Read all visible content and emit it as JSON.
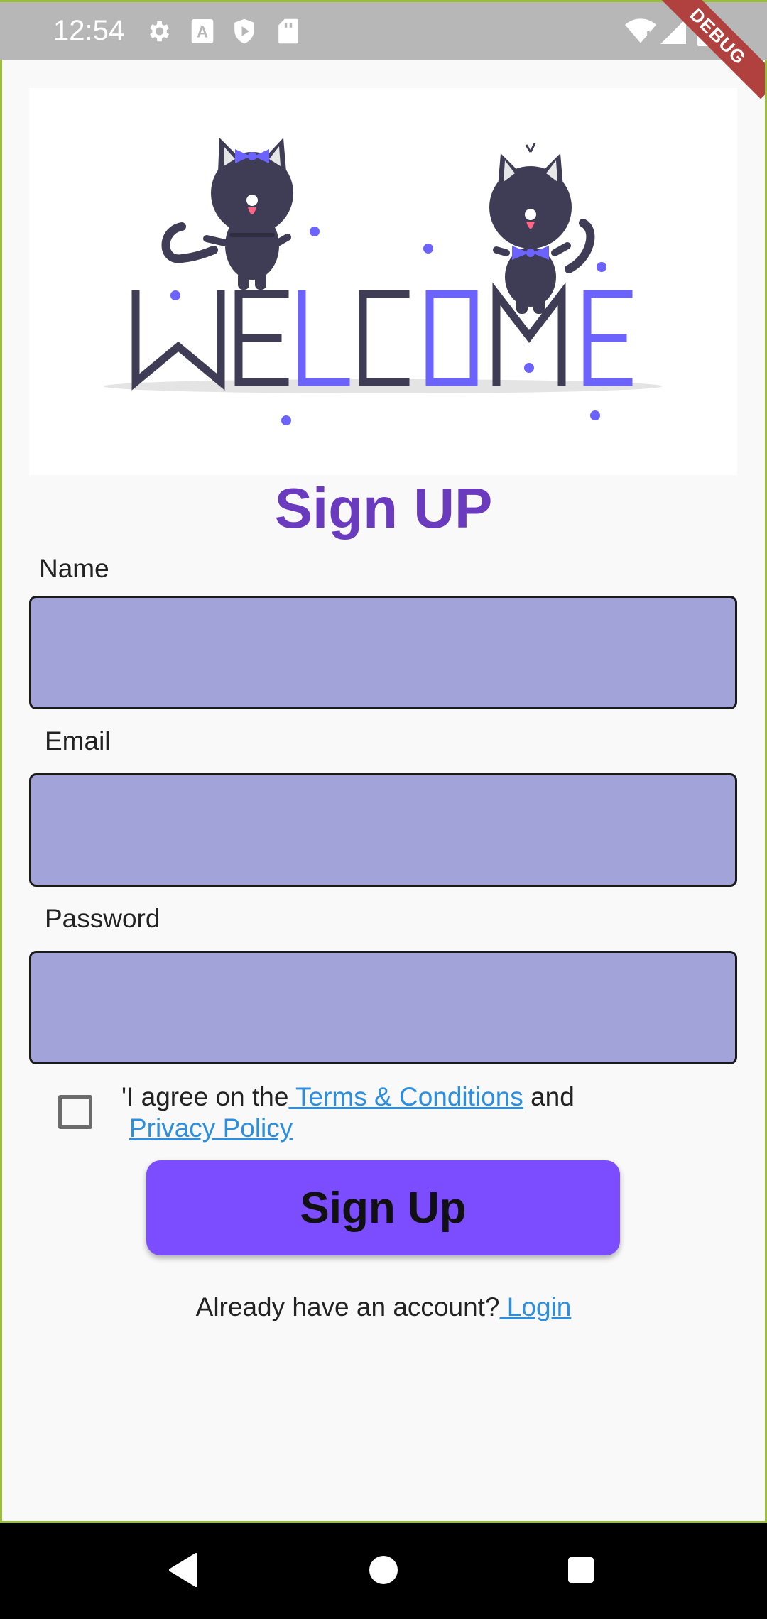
{
  "status_bar": {
    "time": "12:54",
    "icons": [
      "gear-icon",
      "text-a-icon",
      "shield-play-icon",
      "sd-card-icon",
      "wifi-icon",
      "signal-icon",
      "battery-icon"
    ],
    "debug_label": "DEBUG"
  },
  "hero": {
    "welcome_text": "WELCOME",
    "accent_color": "#6c63ff",
    "dark_color": "#3f3d56"
  },
  "page": {
    "title": "Sign UP"
  },
  "form": {
    "name_label": "Name",
    "email_label": "Email",
    "password_label": "Password",
    "name_value": "",
    "email_value": "",
    "password_value": "",
    "agree_checked": false,
    "agree_prefix": "'I agree on the",
    "terms_link": " Terms & Conditions",
    "agree_and": " and",
    "privacy_link": "Privacy Policy",
    "submit_label": "Sign Up"
  },
  "footer": {
    "already_text": "Already have an account?",
    "login_link": " Login"
  },
  "colors": {
    "title": "#6a3bbf",
    "input_fill": "#a2a3d8",
    "button": "#7c4dff",
    "link": "#2b8ee0"
  }
}
